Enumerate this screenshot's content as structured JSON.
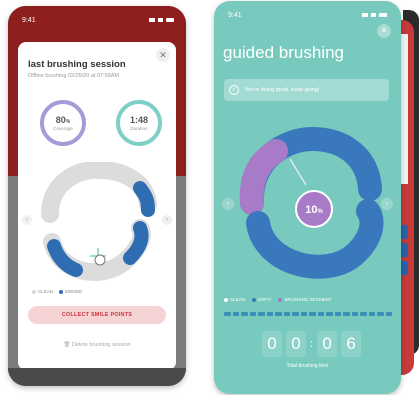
{
  "left_screen": {
    "status_time": "9:41",
    "title": "last brushing session",
    "subtitle": "Offline brushing 02/25/20 at 07:58AM",
    "close_icon": "close-icon",
    "coverage": {
      "value": "80",
      "unit": "%",
      "label": "Coverage",
      "percent": 80
    },
    "duration": {
      "value": "1:48",
      "label": "Duration"
    },
    "legend": [
      {
        "label": "CLEAN",
        "color": "#d6d6d6"
      },
      {
        "label": "MISSED",
        "color": "#2f6db3"
      }
    ],
    "collect_button": "COLLECT SMILE POINTS",
    "delete_label": "Delete brushing session"
  },
  "right_screen": {
    "status_time": "9:41",
    "title": "guided brushing",
    "banner_text": "You're doing good, keep going!",
    "center_value": "10",
    "center_unit": "%",
    "legend": [
      {
        "label": "CLEAN",
        "color": "#ffffff"
      },
      {
        "label": "DIRTY",
        "color": "#3a78bd"
      },
      {
        "label": "BRUSHING SEGMENT",
        "color": "#a77bc7"
      }
    ],
    "timer_digits": [
      "0",
      "0",
      "0",
      "6"
    ],
    "timer_label": "Total brushing time"
  },
  "colors": {
    "teal": "#78c9be",
    "accent_red": "#d0343d",
    "purple": "#a79ad8",
    "blue": "#2f6db3"
  }
}
